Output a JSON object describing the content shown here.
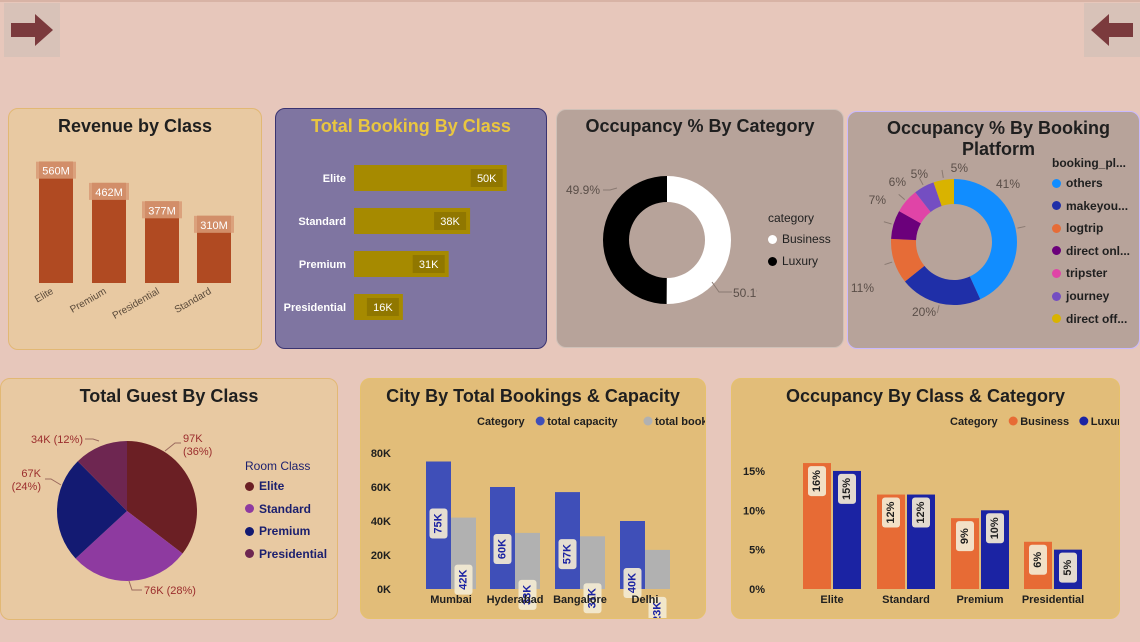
{
  "nav": {
    "left_icon": "arrow-right-icon",
    "right_icon": "arrow-left-icon",
    "icon_color": "#7b3a3d"
  },
  "colors": {
    "brown": "#b04a22",
    "gold": "#a68a00",
    "purple_card": "#7f75a1",
    "tan_card": "#e8c9a2",
    "taupe_card": "#b7a39a",
    "yellow_card": "#e2bd79",
    "orange": "#e76b35",
    "navy": "#1b23a3",
    "blue": "#3f4fb8",
    "grey": "#b1b1b1"
  },
  "revenue": {
    "title": "Revenue by Class",
    "chart_data": {
      "type": "bar",
      "categories": [
        "Elite",
        "Premium",
        "Presidential",
        "Standard"
      ],
      "values": [
        560,
        462,
        377,
        310
      ],
      "labels": [
        "560M",
        "462M",
        "377M",
        "310M"
      ],
      "units": "M",
      "ylim": [
        0,
        600
      ]
    }
  },
  "booking": {
    "title": "Total Booking By Class",
    "chart_data": {
      "type": "bar",
      "orientation": "horizontal",
      "categories": [
        "Elite",
        "Standard",
        "Premium",
        "Presidential"
      ],
      "values": [
        50,
        38,
        31,
        16
      ],
      "labels": [
        "50K",
        "38K",
        "31K",
        "16K"
      ],
      "units": "K",
      "xlim": [
        0,
        55
      ]
    }
  },
  "occ_cat": {
    "title": "Occupancy % By Category",
    "legend_title": "category",
    "chart_data": {
      "type": "pie",
      "donut": true,
      "categories": [
        "Business",
        "Luxury"
      ],
      "values": [
        50.1,
        49.9
      ],
      "labels": [
        "50.1%",
        "49.9%"
      ],
      "colors": [
        "#ffffff",
        "#000000"
      ]
    }
  },
  "occ_platform": {
    "title": "Occupancy % By Booking Platform",
    "legend_title": "booking_pl...",
    "chart_data": {
      "type": "pie",
      "donut": true,
      "categories": [
        "others",
        "makeyou...",
        "logtrip",
        "direct onl...",
        "tripster",
        "journey",
        "direct off..."
      ],
      "values": [
        41,
        20,
        11,
        7,
        6,
        5,
        5
      ],
      "labels": [
        "41%",
        "20%",
        "11%",
        "7%",
        "6%",
        "5%",
        "5%"
      ],
      "colors": [
        "#118dff",
        "#1f2fa8",
        "#e66c37",
        "#6b007b",
        "#e044a7",
        "#744ec2",
        "#d9b300"
      ]
    }
  },
  "guest": {
    "title": "Total Guest By Class",
    "legend_title": "Room Class",
    "chart_data": {
      "type": "pie",
      "categories": [
        "Elite",
        "Standard",
        "Premium",
        "Presidential"
      ],
      "values": [
        97,
        76,
        67,
        34
      ],
      "percents": [
        "36%",
        "28%",
        "24%",
        "12%"
      ],
      "labels": [
        "97K (36%)",
        "76K (28%)",
        "67K (24%)",
        "34K (12%)"
      ],
      "colors": [
        "#6b1f24",
        "#8e3aa0",
        "#131a72",
        "#6e2651"
      ]
    }
  },
  "city": {
    "title": "City By Total Bookings & Capacity",
    "legend_title": "Category",
    "chart_data": {
      "type": "bar",
      "categories": [
        "Mumbai",
        "Hyderabad",
        "Bangalore",
        "Delhi"
      ],
      "series": [
        {
          "name": "total capacity",
          "values": [
            75,
            60,
            57,
            40
          ],
          "labels": [
            "75K",
            "60K",
            "57K",
            "40K"
          ],
          "color": "#3f4fb8"
        },
        {
          "name": "total booking",
          "values": [
            42,
            33,
            31,
            23
          ],
          "labels": [
            "42K",
            "33K",
            "31K",
            "23K"
          ],
          "color": "#b1b1b1"
        }
      ],
      "yticks": [
        "0K",
        "20K",
        "40K",
        "60K",
        "80K"
      ],
      "ylim": [
        0,
        80
      ]
    }
  },
  "occ_class": {
    "title": "Occupancy By Class & Category",
    "legend_title": "Category",
    "chart_data": {
      "type": "bar",
      "categories": [
        "Elite",
        "Standard",
        "Premium",
        "Presidential"
      ],
      "series": [
        {
          "name": "Business",
          "values": [
            16,
            12,
            9,
            6
          ],
          "labels": [
            "16%",
            "12%",
            "9%",
            "6%"
          ],
          "color": "#e76b35"
        },
        {
          "name": "Luxury",
          "values": [
            15,
            12,
            10,
            5
          ],
          "labels": [
            "15%",
            "12%",
            "10%",
            "5%"
          ],
          "color": "#1b23a3"
        }
      ],
      "yticks": [
        "0%",
        "5%",
        "10%",
        "15%"
      ],
      "ylim": [
        0,
        15.5
      ]
    }
  }
}
